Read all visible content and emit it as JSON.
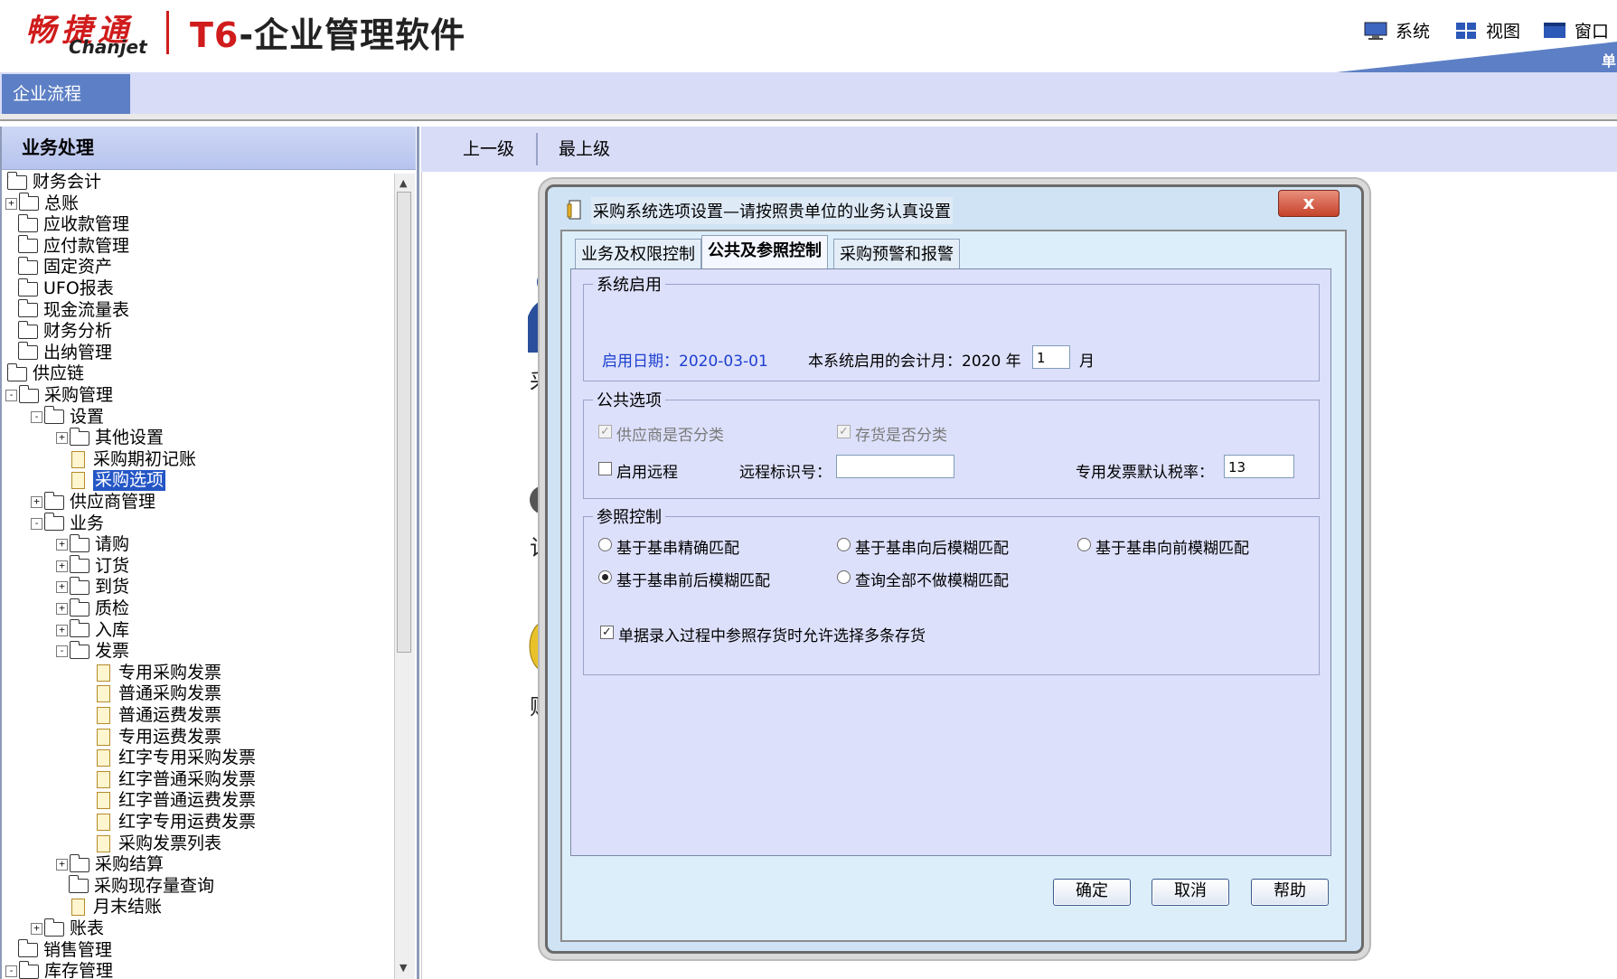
{
  "header": {
    "logo_cn": "畅捷通",
    "logo_en": "Chanjet",
    "product_prefix": "T6",
    "product_rest": "-企业管理软件",
    "menus": [
      {
        "label": "系统",
        "icon": "monitor-icon"
      },
      {
        "label": "视图",
        "icon": "grid-icon"
      },
      {
        "label": "窗口",
        "icon": "window-icon"
      }
    ],
    "corner_text": "单"
  },
  "tabstrip": {
    "active_tab": "企业流程"
  },
  "left_panel": {
    "title": "业务处理",
    "tree": [
      {
        "label": "财务会计",
        "level": 0,
        "type": "folder",
        "exp": ""
      },
      {
        "label": "总账",
        "level": 1,
        "type": "folder",
        "exp": "+"
      },
      {
        "label": "应收款管理",
        "level": 1,
        "type": "folder",
        "exp": ""
      },
      {
        "label": "应付款管理",
        "level": 1,
        "type": "folder",
        "exp": ""
      },
      {
        "label": "固定资产",
        "level": 1,
        "type": "folder",
        "exp": ""
      },
      {
        "label": "UFO报表",
        "level": 1,
        "type": "folder",
        "exp": ""
      },
      {
        "label": "现金流量表",
        "level": 1,
        "type": "folder",
        "exp": ""
      },
      {
        "label": "财务分析",
        "level": 1,
        "type": "folder",
        "exp": ""
      },
      {
        "label": "出纳管理",
        "level": 1,
        "type": "folder",
        "exp": ""
      },
      {
        "label": "供应链",
        "level": 0,
        "type": "folder",
        "exp": ""
      },
      {
        "label": "采购管理",
        "level": 1,
        "type": "folder",
        "exp": "-"
      },
      {
        "label": "设置",
        "level": 2,
        "type": "folder",
        "exp": "-"
      },
      {
        "label": "其他设置",
        "level": 3,
        "type": "folder",
        "exp": "+"
      },
      {
        "label": "采购期初记账",
        "level": 3,
        "type": "doc",
        "exp": ""
      },
      {
        "label": "采购选项",
        "level": 3,
        "type": "doc",
        "exp": "",
        "selected": true
      },
      {
        "label": "供应商管理",
        "level": 2,
        "type": "folder",
        "exp": "+"
      },
      {
        "label": "业务",
        "level": 2,
        "type": "folder",
        "exp": "-"
      },
      {
        "label": "请购",
        "level": 3,
        "type": "folder",
        "exp": "+"
      },
      {
        "label": "订货",
        "level": 3,
        "type": "folder",
        "exp": "+"
      },
      {
        "label": "到货",
        "level": 3,
        "type": "folder",
        "exp": "+"
      },
      {
        "label": "质检",
        "level": 3,
        "type": "folder",
        "exp": "+"
      },
      {
        "label": "入库",
        "level": 3,
        "type": "folder",
        "exp": "+"
      },
      {
        "label": "发票",
        "level": 3,
        "type": "folder",
        "exp": "-"
      },
      {
        "label": "专用采购发票",
        "level": 4,
        "type": "doc",
        "exp": ""
      },
      {
        "label": "普通采购发票",
        "level": 4,
        "type": "doc",
        "exp": ""
      },
      {
        "label": "普通运费发票",
        "level": 4,
        "type": "doc",
        "exp": ""
      },
      {
        "label": "专用运费发票",
        "level": 4,
        "type": "doc",
        "exp": ""
      },
      {
        "label": "红字专用采购发票",
        "level": 4,
        "type": "doc",
        "exp": ""
      },
      {
        "label": "红字普通采购发票",
        "level": 4,
        "type": "doc",
        "exp": ""
      },
      {
        "label": "红字普通运费发票",
        "level": 4,
        "type": "doc",
        "exp": ""
      },
      {
        "label": "红字专用运费发票",
        "level": 4,
        "type": "doc",
        "exp": ""
      },
      {
        "label": "采购发票列表",
        "level": 4,
        "type": "doc",
        "exp": ""
      },
      {
        "label": "采购结算",
        "level": 3,
        "type": "folder",
        "exp": "+"
      },
      {
        "label": "采购现存量查询",
        "level": 3,
        "type": "folder",
        "exp": ""
      },
      {
        "label": "月末结账",
        "level": 3,
        "type": "doc",
        "exp": ""
      },
      {
        "label": "账表",
        "level": 2,
        "type": "folder",
        "exp": "+"
      },
      {
        "label": "销售管理",
        "level": 1,
        "type": "folder",
        "exp": ""
      },
      {
        "label": "库存管理",
        "level": 1,
        "type": "folder",
        "exp": "-"
      }
    ]
  },
  "nav": {
    "up": "上一级",
    "top": "最上级"
  },
  "background_labels": {
    "a": "采",
    "b": "计",
    "c": "财"
  },
  "dialog": {
    "title": "采购系统选项设置—请按照贵单位的业务认真设置",
    "close_label": "x",
    "tabs": [
      "业务及权限控制",
      "公共及参照控制",
      "采购预警和报警"
    ],
    "active_tab_index": 1,
    "system_enable": {
      "group_label": "系统启用",
      "enable_date_label": "启用日期：2020-03-01",
      "period_label": "本系统启用的会计月：2020 年",
      "period_value": "1",
      "month_unit": "月"
    },
    "common_options": {
      "group_label": "公共选项",
      "supplier_classified": {
        "label": "供应商是否分类",
        "checked": true,
        "disabled": true
      },
      "inventory_classified": {
        "label": "存货是否分类",
        "checked": true,
        "disabled": true
      },
      "enable_remote": {
        "label": "启用远程",
        "checked": false
      },
      "remote_id_label": "远程标识号：",
      "remote_id_value": "",
      "tax_rate_label": "专用发票默认税率：",
      "tax_rate_value": "13"
    },
    "reference_control": {
      "group_label": "参照控制",
      "radios": [
        {
          "label": "基于基串精确匹配",
          "checked": false
        },
        {
          "label": "基于基串向后模糊匹配",
          "checked": false
        },
        {
          "label": "基于基串向前模糊匹配",
          "checked": false
        },
        {
          "label": "基于基串前后模糊匹配",
          "checked": true
        },
        {
          "label": "查询全部不做模糊匹配",
          "checked": false
        }
      ],
      "multi_select": {
        "label": "单据录入过程中参照存货时允许选择多条存货",
        "checked": true
      }
    },
    "buttons": {
      "ok": "确定",
      "cancel": "取消",
      "help": "帮助"
    }
  }
}
